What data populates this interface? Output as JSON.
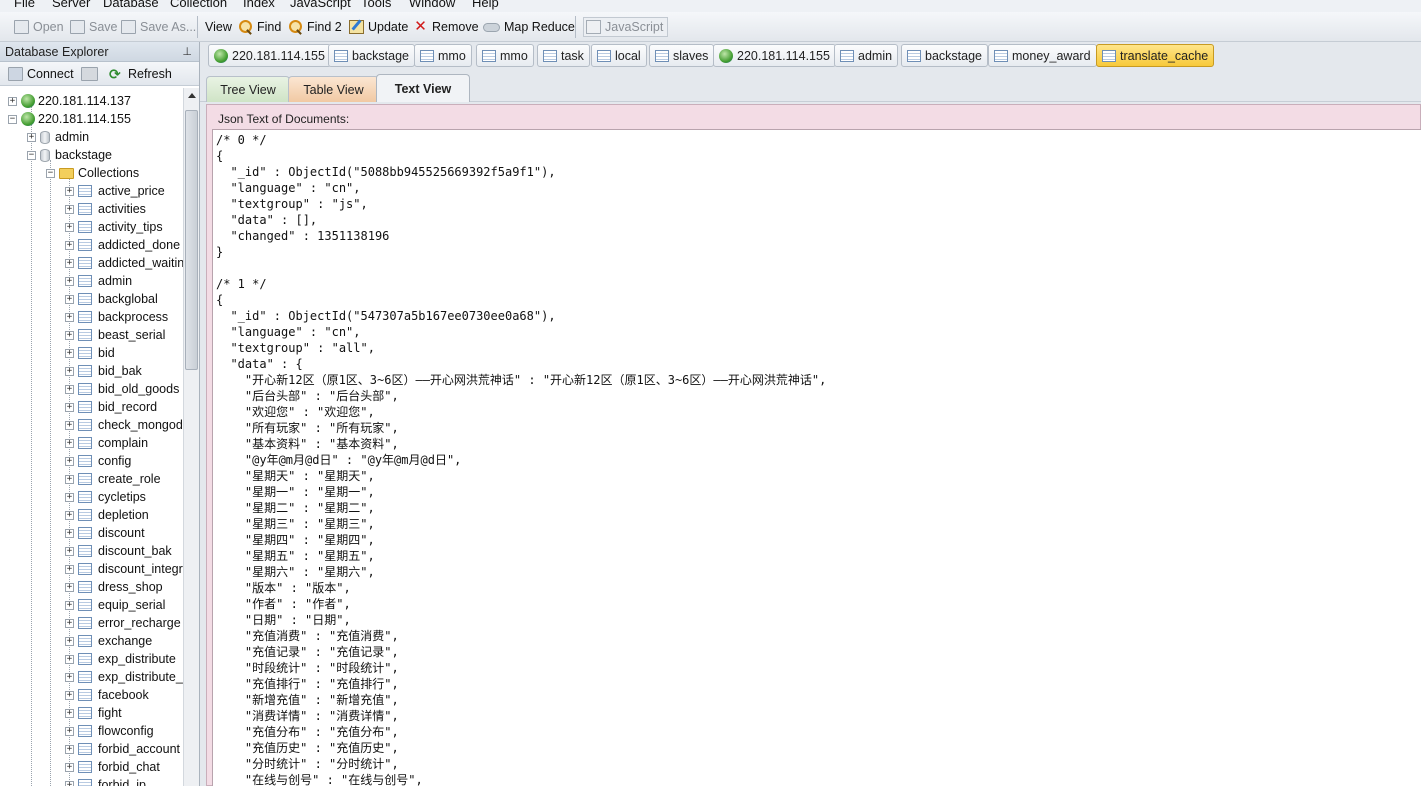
{
  "menu": [
    "File",
    "Server",
    "Database",
    "Collection",
    "Index",
    "JavaScript",
    "Tools",
    "Window",
    "Help"
  ],
  "toolbar": {
    "open": "Open",
    "save": "Save",
    "save_as": "Save As...",
    "view": "View",
    "find": "Find",
    "find2": "Find 2",
    "update": "Update",
    "remove": "Remove",
    "map_reduce": "Map Reduce",
    "javascript": "JavaScript"
  },
  "explorer": {
    "title": "Database Explorer",
    "connect": "Connect",
    "refresh": "Refresh",
    "servers": [
      "220.181.114.137",
      "220.181.114.155"
    ],
    "databases": [
      "admin",
      "backstage"
    ],
    "collections_label": "Collections",
    "collections": [
      "active_price",
      "activities",
      "activity_tips",
      "addicted_done",
      "addicted_waitin",
      "admin",
      "backglobal",
      "backprocess",
      "beast_serial",
      "bid",
      "bid_bak",
      "bid_old_goods",
      "bid_record",
      "check_mongod",
      "complain",
      "config",
      "create_role",
      "cycletips",
      "depletion",
      "discount",
      "discount_bak",
      "discount_integr",
      "dress_shop",
      "equip_serial",
      "error_recharge",
      "exchange",
      "exp_distribute",
      "exp_distribute_e",
      "facebook",
      "fight",
      "flowconfig",
      "forbid_account",
      "forbid_chat",
      "forbid_ip"
    ]
  },
  "doc_tabs": [
    {
      "label": "220.181.114.155",
      "icon": "server-globe-icon"
    },
    {
      "label": "backstage",
      "icon": "table-icon"
    },
    {
      "label": "mmo",
      "icon": "table-icon"
    },
    {
      "label": "mmo",
      "icon": "table-icon"
    },
    {
      "label": "task",
      "icon": "table-icon"
    },
    {
      "label": "local",
      "icon": "table-icon"
    },
    {
      "label": "slaves",
      "icon": "table-icon"
    },
    {
      "label": "220.181.114.155",
      "icon": "server-globe-icon"
    },
    {
      "label": "admin",
      "icon": "table-icon"
    },
    {
      "label": "backstage",
      "icon": "table-icon"
    },
    {
      "label": "money_award",
      "icon": "table-icon"
    },
    {
      "label": "translate_cache",
      "icon": "table-icon",
      "active": true
    }
  ],
  "view_tabs": {
    "tree": "Tree View",
    "table": "Table View",
    "text": "Text View",
    "active": "Text View"
  },
  "json_panel": {
    "label": "Json Text of Documents:",
    "lines": [
      "/* 0 */",
      "{",
      "  \"_id\" : ObjectId(\"5088bb945525669392f5a9f1\"),",
      "  \"language\" : \"cn\",",
      "  \"textgroup\" : \"js\",",
      "  \"data\" : [],",
      "  \"changed\" : 1351138196",
      "}",
      "",
      "/* 1 */",
      "{",
      "  \"_id\" : ObjectId(\"547307a5b167ee0730ee0a68\"),",
      "  \"language\" : \"cn\",",
      "  \"textgroup\" : \"all\",",
      "  \"data\" : {",
      "    \"开心新12区（原1区、3~6区）——开心网洪荒神话\" : \"开心新12区（原1区、3~6区）——开心网洪荒神话\",",
      "    \"后台头部\" : \"后台头部\",",
      "    \"欢迎您\" : \"欢迎您\",",
      "    \"所有玩家\" : \"所有玩家\",",
      "    \"基本资料\" : \"基本资料\",",
      "    \"@y年@m月@d日\" : \"@y年@m月@d日\",",
      "    \"星期天\" : \"星期天\",",
      "    \"星期一\" : \"星期一\",",
      "    \"星期二\" : \"星期二\",",
      "    \"星期三\" : \"星期三\",",
      "    \"星期四\" : \"星期四\",",
      "    \"星期五\" : \"星期五\",",
      "    \"星期六\" : \"星期六\",",
      "    \"版本\" : \"版本\",",
      "    \"作者\" : \"作者\",",
      "    \"日期\" : \"日期\",",
      "    \"充值消费\" : \"充值消费\",",
      "    \"充值记录\" : \"充值记录\",",
      "    \"时段统计\" : \"时段统计\",",
      "    \"充值排行\" : \"充值排行\",",
      "    \"新增充值\" : \"新增充值\",",
      "    \"消费详情\" : \"消费详情\",",
      "    \"充值分布\" : \"充值分布\",",
      "    \"充值历史\" : \"充值历史\",",
      "    \"分时统计\" : \"分时统计\",",
      "    \"在线与创号\" : \"在线与创号\","
    ]
  }
}
